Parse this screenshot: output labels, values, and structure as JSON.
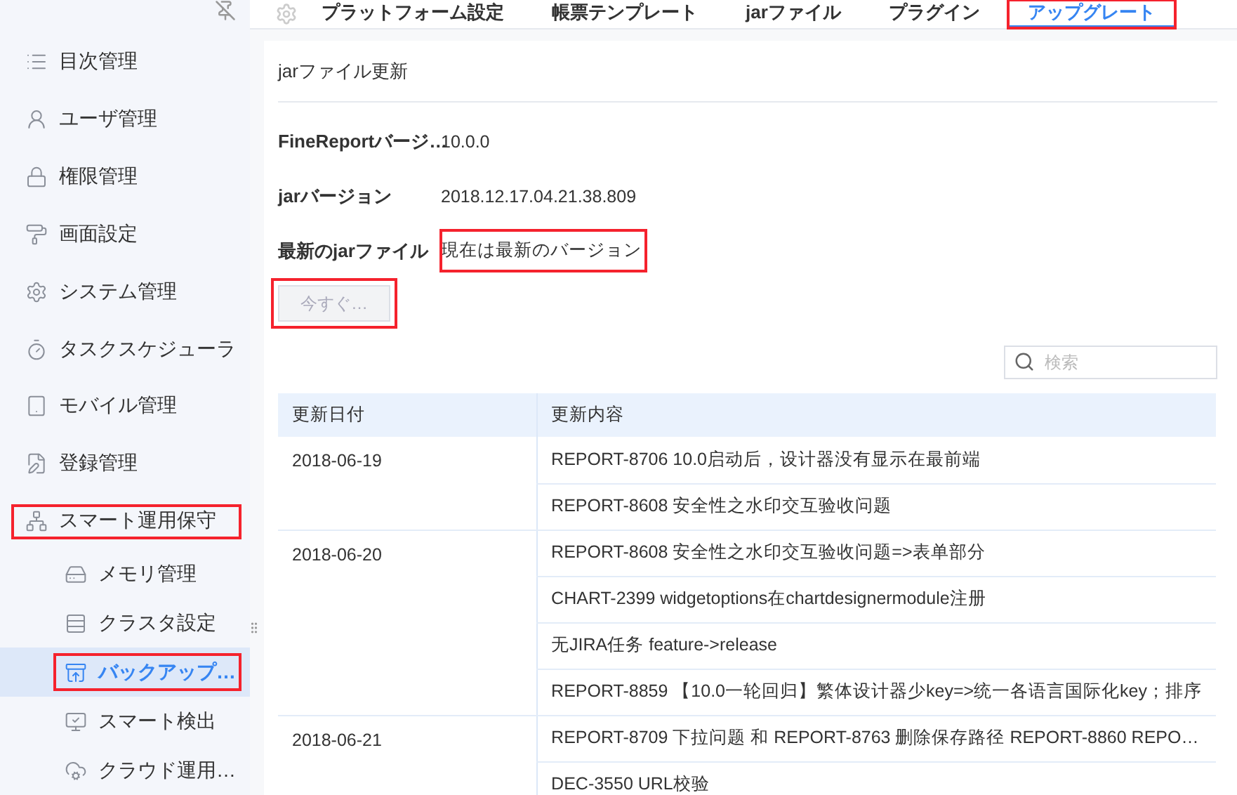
{
  "sidebar": {
    "items": [
      {
        "label": "目次管理",
        "selected": false,
        "highlighted": false
      },
      {
        "label": "ユーザ管理",
        "selected": false,
        "highlighted": false
      },
      {
        "label": "権限管理",
        "selected": false,
        "highlighted": false
      },
      {
        "label": "画面設定",
        "selected": false,
        "highlighted": false
      },
      {
        "label": "システム管理",
        "selected": false,
        "highlighted": false
      },
      {
        "label": "タスクスケジューラ",
        "selected": false,
        "highlighted": false
      },
      {
        "label": "モバイル管理",
        "selected": false,
        "highlighted": false
      },
      {
        "label": "登録管理",
        "selected": false,
        "highlighted": false
      },
      {
        "label": "スマート運用保守",
        "selected": false,
        "highlighted": true,
        "expanded": true,
        "children": [
          {
            "label": "メモリ管理",
            "selected": false,
            "highlighted": false
          },
          {
            "label": "クラスタ設定",
            "selected": false,
            "highlighted": false
          },
          {
            "label": "バックアップ…",
            "selected": true,
            "highlighted": true
          },
          {
            "label": "スマート検出",
            "selected": false,
            "highlighted": false
          },
          {
            "label": "クラウド運用…",
            "selected": false,
            "highlighted": false
          }
        ]
      }
    ]
  },
  "tabs": [
    {
      "label": "プラットフォーム設定",
      "selected": false,
      "highlighted": false
    },
    {
      "label": "帳票テンプレート",
      "selected": false,
      "highlighted": false
    },
    {
      "label": "jarファイル",
      "selected": false,
      "highlighted": false
    },
    {
      "label": "プラグイン",
      "selected": false,
      "highlighted": false
    },
    {
      "label": "アップグレート",
      "selected": true,
      "highlighted": true
    }
  ],
  "panel": {
    "title": "jarファイル更新",
    "fields": [
      {
        "label": "FineReportバージ…",
        "value": "10.0.0",
        "highlighted": false
      },
      {
        "label": "jarバージョン",
        "value": "2018.12.17.04.21.38.809",
        "highlighted": false
      },
      {
        "label": "最新のjarファイル",
        "value": "現在は最新のバージョン",
        "highlighted": true
      }
    ],
    "button": {
      "label": "今すぐ…",
      "disabled": true,
      "highlighted": true
    },
    "search": {
      "placeholder": "検索"
    },
    "table": {
      "columns": [
        "更新日付",
        "更新内容"
      ],
      "rows": [
        {
          "date": "2018-06-19",
          "items": [
            "REPORT-8706 10.0启动后，设计器没有显示在最前端",
            "REPORT-8608 安全性之水印交互验收问题"
          ]
        },
        {
          "date": "2018-06-20",
          "items": [
            "REPORT-8608 安全性之水印交互验收问题=>表单部分",
            "CHART-2399  widgetoptions在chartdesignermodule注册",
            "无JIRA任务 feature->release",
            "REPORT-8859 【10.0一轮回归】繁体设计器少key=>统一各语言国际化key；排序"
          ]
        },
        {
          "date": "2018-06-21",
          "items": [
            "REPORT-8709 下拉问题 和 REPORT-8763 删除保存路径 REPORT-8860  REPO…",
            "DEC-3550 URL校验"
          ]
        }
      ]
    }
  }
}
